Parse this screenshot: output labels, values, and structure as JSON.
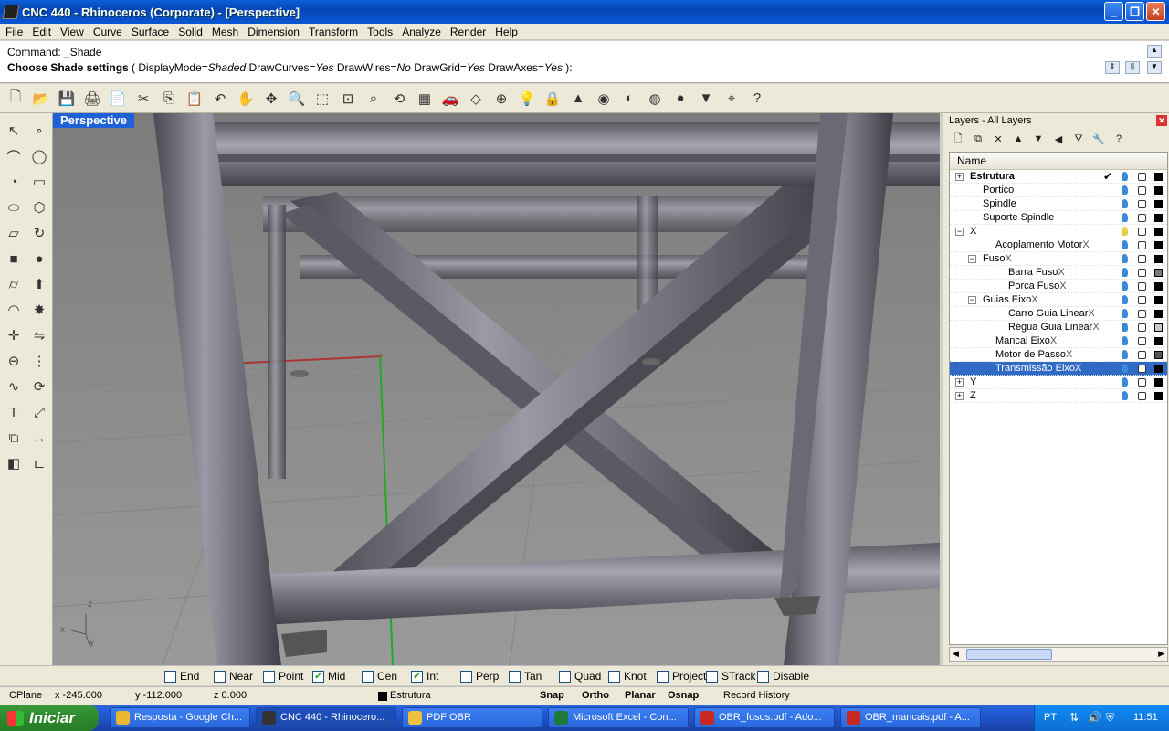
{
  "window": {
    "title": "CNC  440 - Rhinoceros (Corporate) - [Perspective]"
  },
  "menu": [
    "File",
    "Edit",
    "View",
    "Curve",
    "Surface",
    "Solid",
    "Mesh",
    "Dimension",
    "Transform",
    "Tools",
    "Analyze",
    "Render",
    "Help"
  ],
  "command": {
    "history": "Command: _Shade",
    "prompt_bold": "Choose Shade settings",
    "prompt_open": " ( ",
    "opt1_key": "DisplayMode=",
    "opt1_val": "Shaded",
    "opt2_key": " DrawCurves=",
    "opt2_val": "Yes",
    "opt3_key": " DrawWires=",
    "opt3_val": "No",
    "opt4_key": " DrawGrid=",
    "opt4_val": "Yes",
    "opt5_key": " DrawAxes=",
    "opt5_val": "Yes",
    "prompt_close": " ):"
  },
  "toolbar_icons": [
    "new-file-icon",
    "open-icon",
    "save-icon",
    "print-icon",
    "import-icon",
    "cut-icon",
    "copy-icon",
    "paste-icon",
    "undo-icon",
    "pan-icon",
    "rotate-view-icon",
    "zoom-dynamic-icon",
    "zoom-window-icon",
    "zoom-extents-icon",
    "zoom-selected-icon",
    "zoom-previous-icon",
    "four-viewports-icon",
    "car-icon",
    "cplane-icon",
    "grid-snap-icon",
    "light-bulb-icon",
    "lock-icon",
    "render-icon",
    "color-wheel-icon",
    "sphere-icon",
    "shade-icon",
    "ghost-icon",
    "properties-icon",
    "select-icon",
    "help-icon"
  ],
  "toolbar_glyphs": [
    "🗋",
    "📂",
    "💾",
    "🖨",
    "📄",
    "✂",
    "⎘",
    "📋",
    "↶",
    "✋",
    "✥",
    "🔍",
    "⬚",
    "⊡",
    "⌕",
    "⟲",
    "▦",
    "🚗",
    "◇",
    "⊕",
    "💡",
    "🔒",
    "▲",
    "◉",
    "◐",
    "◍",
    "●",
    "▼",
    "⌖",
    "?"
  ],
  "viewport": {
    "label": "Perspective",
    "axis_x": "x",
    "axis_y": "y",
    "axis_z": "z"
  },
  "layers": {
    "header": "Layers - All Layers",
    "column": "Name",
    "rows": [
      {
        "name": "Estrutura",
        "suffix": "",
        "indent": 0,
        "expander": "+",
        "bold": true,
        "current": true,
        "selected": false,
        "swatch": "#000000",
        "bulb": "#3a8ad9"
      },
      {
        "name": "Portico",
        "suffix": "",
        "indent": 1,
        "expander": "",
        "bold": false,
        "current": false,
        "selected": false,
        "swatch": "#000000",
        "bulb": "#3a8ad9"
      },
      {
        "name": "Spindle",
        "suffix": "",
        "indent": 1,
        "expander": "",
        "bold": false,
        "current": false,
        "selected": false,
        "swatch": "#000000",
        "bulb": "#3a8ad9"
      },
      {
        "name": "Suporte Spindle",
        "suffix": "",
        "indent": 1,
        "expander": "",
        "bold": false,
        "current": false,
        "selected": false,
        "swatch": "#000000",
        "bulb": "#3a8ad9"
      },
      {
        "name": "X",
        "suffix": "",
        "indent": 0,
        "expander": "−",
        "bold": false,
        "current": false,
        "selected": false,
        "swatch": "#000000",
        "bulb": "#e8d040"
      },
      {
        "name": "Acoplamento Motor",
        "suffix": "X",
        "indent": 2,
        "expander": "",
        "bold": false,
        "current": false,
        "selected": false,
        "swatch": "#000000",
        "bulb": "#3a8ad9"
      },
      {
        "name": "Fuso",
        "suffix": "X",
        "indent": 1,
        "expander": "−",
        "bold": false,
        "current": false,
        "selected": false,
        "swatch": "#000000",
        "bulb": "#3a8ad9"
      },
      {
        "name": "Barra Fuso",
        "suffix": "X",
        "indent": 3,
        "expander": "",
        "bold": false,
        "current": false,
        "selected": false,
        "swatch": "#7a7a7a",
        "bulb": "#3a8ad9"
      },
      {
        "name": "Porca Fuso",
        "suffix": "X",
        "indent": 3,
        "expander": "",
        "bold": false,
        "current": false,
        "selected": false,
        "swatch": "#000000",
        "bulb": "#3a8ad9"
      },
      {
        "name": "Guias Eixo",
        "suffix": "X",
        "indent": 1,
        "expander": "−",
        "bold": false,
        "current": false,
        "selected": false,
        "swatch": "#000000",
        "bulb": "#3a8ad9"
      },
      {
        "name": "Carro Guia Linear",
        "suffix": "X",
        "indent": 3,
        "expander": "",
        "bold": false,
        "current": false,
        "selected": false,
        "swatch": "#000000",
        "bulb": "#3a8ad9"
      },
      {
        "name": "Régua Guia Linear",
        "suffix": "X",
        "indent": 3,
        "expander": "",
        "bold": false,
        "current": false,
        "selected": false,
        "swatch": "#c8c8c8",
        "bulb": "#3a8ad9"
      },
      {
        "name": "Mancal Eixo",
        "suffix": "X",
        "indent": 2,
        "expander": "",
        "bold": false,
        "current": false,
        "selected": false,
        "swatch": "#000000",
        "bulb": "#3a8ad9"
      },
      {
        "name": "Motor de Passo",
        "suffix": "X",
        "indent": 2,
        "expander": "",
        "bold": false,
        "current": false,
        "selected": false,
        "swatch": "#555555",
        "bulb": "#3a8ad9"
      },
      {
        "name": "Transmissão Eixo",
        "suffix": "X",
        "indent": 2,
        "expander": "",
        "bold": false,
        "current": false,
        "selected": true,
        "swatch": "#000000",
        "bulb": "#3a8ad9"
      },
      {
        "name": "Y",
        "suffix": "",
        "indent": 0,
        "expander": "+",
        "bold": false,
        "current": false,
        "selected": false,
        "swatch": "#000000",
        "bulb": "#3a8ad9"
      },
      {
        "name": "Z",
        "suffix": "",
        "indent": 0,
        "expander": "+",
        "bold": false,
        "current": false,
        "selected": false,
        "swatch": "#000000",
        "bulb": "#3a8ad9"
      }
    ]
  },
  "osnaps": [
    {
      "label": "End",
      "checked": false
    },
    {
      "label": "Near",
      "checked": false
    },
    {
      "label": "Point",
      "checked": false
    },
    {
      "label": "Mid",
      "checked": true
    },
    {
      "label": "Cen",
      "checked": false
    },
    {
      "label": "Int",
      "checked": true
    },
    {
      "label": "Perp",
      "checked": false
    },
    {
      "label": "Tan",
      "checked": false
    },
    {
      "label": "Quad",
      "checked": false
    },
    {
      "label": "Knot",
      "checked": false
    },
    {
      "label": "Project",
      "checked": false
    },
    {
      "label": "STrack",
      "checked": false
    },
    {
      "label": "Disable",
      "checked": false
    }
  ],
  "status": {
    "cplane": "CPlane",
    "x": "x -245.000",
    "y": "y -112.000",
    "z": "z 0.000",
    "layer": "Estrutura",
    "snap": "Snap",
    "ortho": "Ortho",
    "planar": "Planar",
    "osnap": "Osnap",
    "record": "Record History"
  },
  "taskbar": {
    "start": "Iniciar",
    "tasks": [
      {
        "label": "Resposta - Google Ch...",
        "icon_color": "#e8b830",
        "active": false
      },
      {
        "label": "CNC  440 - Rhinocero...",
        "icon_color": "#333333",
        "active": true
      },
      {
        "label": "PDF OBR",
        "icon_color": "#f0c040",
        "active": false
      },
      {
        "label": "Microsoft Excel - Con...",
        "icon_color": "#1f7a3a",
        "active": false
      },
      {
        "label": "OBR_fusos.pdf - Ado...",
        "icon_color": "#c8281e",
        "active": false
      },
      {
        "label": "OBR_mancais.pdf - A...",
        "icon_color": "#c8281e",
        "active": false
      }
    ],
    "lang": "PT",
    "clock": "11:51"
  },
  "colors": {
    "accent": "#316ac5",
    "viewport_bg": "#8a8a8a"
  }
}
